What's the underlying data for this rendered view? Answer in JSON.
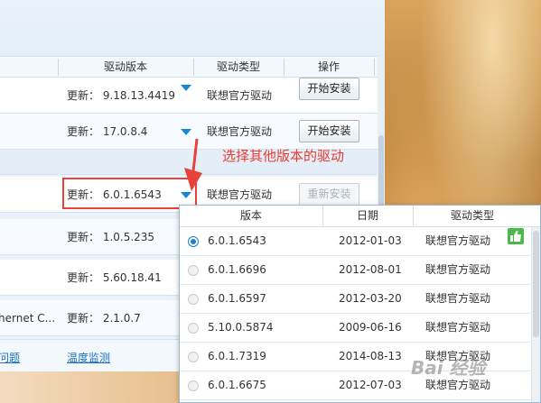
{
  "table": {
    "headers": {
      "version": "驱动版本",
      "type": "驱动类型",
      "action": "操作"
    },
    "rows": [
      {
        "name": "",
        "version": "更新：  9.18.13.4419",
        "type": "联想官方驱动",
        "button": "开始安装",
        "button_disabled": false
      },
      {
        "name": "",
        "version": "更新：  17.0.8.4",
        "type": "联想官方驱动",
        "button": "开始安装",
        "button_disabled": false
      },
      {
        "name": "",
        "version": "更新：  6.0.1.6543",
        "type": "联想官方驱动",
        "button": "重新安装",
        "button_disabled": true
      },
      {
        "name": "",
        "version": "更新：  1.0.5.235",
        "type": "",
        "button": "",
        "button_disabled": false
      },
      {
        "name": "",
        "version": "更新：  5.60.18.41",
        "type": "",
        "button": "",
        "button_disabled": false
      },
      {
        "name": "hernet C...",
        "version": "更新：  2.1.0.7",
        "type": "",
        "button": "",
        "button_disabled": false
      }
    ]
  },
  "bottom_links": {
    "left": "问题",
    "temperature": "温度监测"
  },
  "annotation": {
    "text": "选择其他版本的驱动",
    "color": "#ec3b2f"
  },
  "dropdown": {
    "headers": {
      "version": "版本",
      "date": "日期",
      "type": "驱动类型"
    },
    "rows": [
      {
        "version": "6.0.1.6543",
        "date": "2012-01-03",
        "type": "联想官方驱动",
        "selected": true,
        "recommended": true
      },
      {
        "version": "6.0.1.6696",
        "date": "2012-08-01",
        "type": "联想官方驱动",
        "selected": false
      },
      {
        "version": "6.0.1.6597",
        "date": "2012-03-20",
        "type": "联想官方驱动",
        "selected": false
      },
      {
        "version": "5.10.0.5874",
        "date": "2009-06-16",
        "type": "联想官方驱动",
        "selected": false
      },
      {
        "version": "6.0.1.7319",
        "date": "2014-08-13",
        "type": "联想官方驱动",
        "selected": false
      },
      {
        "version": "6.0.1.6675",
        "date": "2012-07-03",
        "type": "联想官方驱动",
        "selected": false
      }
    ]
  },
  "watermark": "Bai 经验",
  "colors": {
    "accent": "#1a86d0",
    "link": "#1a6fc4",
    "highlight": "#e8413a"
  }
}
